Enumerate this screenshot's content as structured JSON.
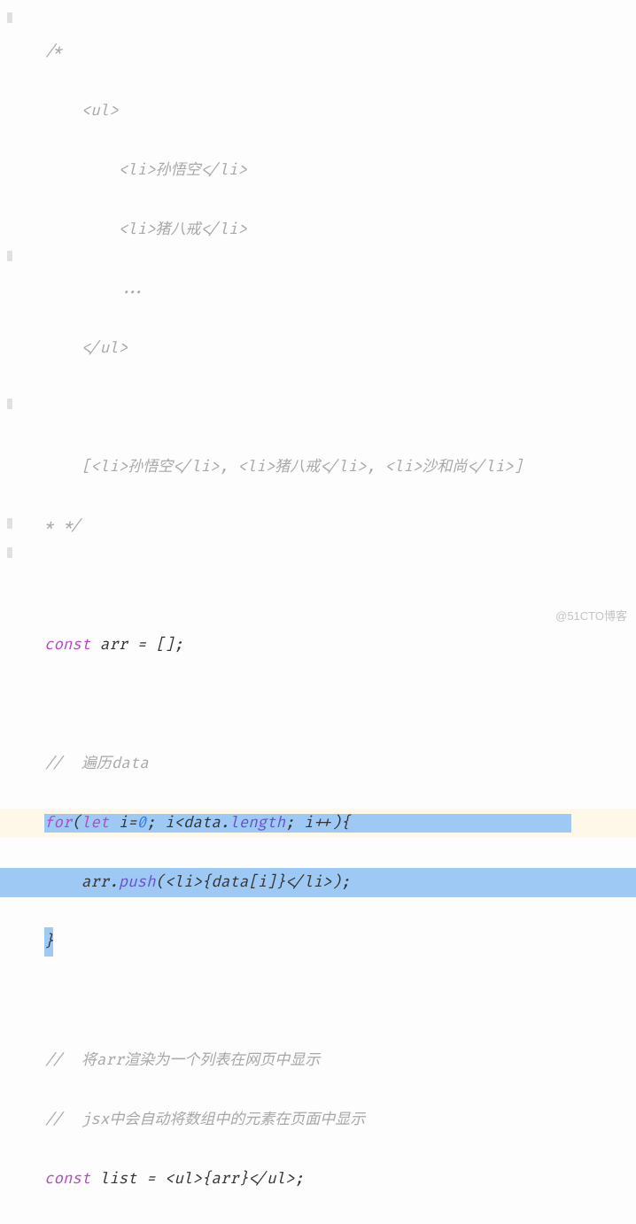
{
  "lines": {
    "l1": "/*",
    "l2": "    <ul>",
    "l3": "        <li>孙悟空</li>",
    "l4": "        <li>猪八戒</li>",
    "l5": "        ...",
    "l6": "    </ul>",
    "l7": "",
    "l8": "    [<li>孙悟空</li>, <li>猪八戒</li>, <li>沙和尚</li>]",
    "l9": "* */",
    "l10": "",
    "l11_kw": "const",
    "l11_rest": " arr = [];",
    "l12": "",
    "l13": "//  遍历data",
    "l14_kw1": "for",
    "l14_a": "(",
    "l14_kw2": "let",
    "l14_b": " i=",
    "l14_num": "0",
    "l14_c": "; i<data.",
    "l14_prop": "length",
    "l14_d": "; i++){",
    "l15_a": "    arr.",
    "l15_prop": "push",
    "l15_b": "(<",
    "l15_tag1": "li",
    "l15_c": ">{data[i]}</",
    "l15_tag2": "li",
    "l15_d": ">);",
    "l16": "}",
    "l17": "",
    "l18": "//  将arr渲染为一个列表在网页中显示",
    "l19": "//  jsx中会自动将数组中的元素在页面中显示",
    "l20_kw": "const",
    "l20_a": " list = <",
    "l20_tag1": "ul",
    "l20_b": ">{arr}</",
    "l20_tag2": "ul",
    "l20_c": ">;"
  },
  "watermark": "@51CTO博客"
}
